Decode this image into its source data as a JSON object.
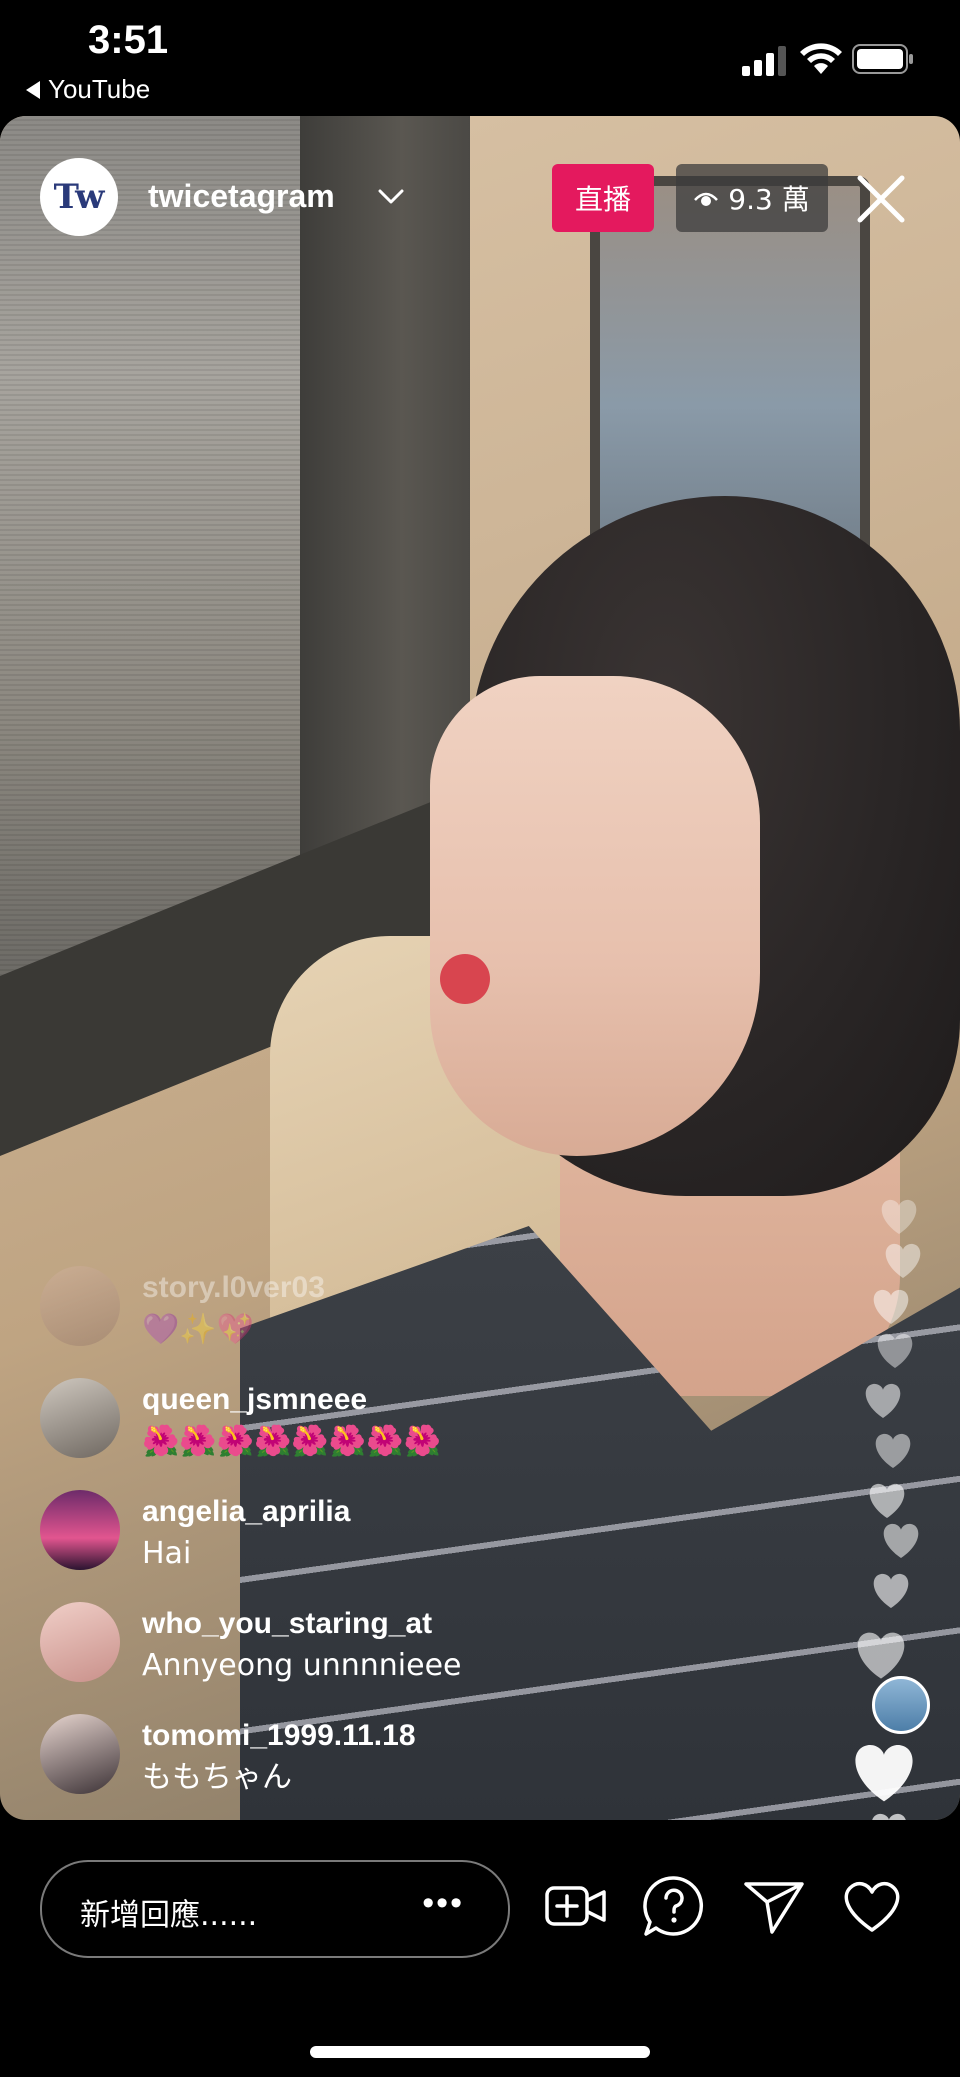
{
  "status_bar": {
    "time": "3:51",
    "back_app": "YouTube"
  },
  "live": {
    "account_handle": "twicetagram",
    "avatar_logo_text": "Tw",
    "live_label": "直播",
    "viewer_count": "9.3 萬"
  },
  "comments": [
    {
      "username": "story.l0ver03",
      "text": "💜✨💖",
      "faded": true
    },
    {
      "username": "queen_jsmneee",
      "text": "🌺🌺🌺🌺🌺🌺🌺🌺"
    },
    {
      "username": "angelia_aprilia",
      "text": "Hai"
    },
    {
      "username": "who_you_staring_at",
      "text": "Annyeong unnnnieee"
    },
    {
      "username": "tomomi_1999.11.18",
      "text": "ももちゃん"
    }
  ],
  "bottom_bar": {
    "comment_placeholder": "新增回應......",
    "more": "•••"
  },
  "colors": {
    "live_badge": "#e4195e",
    "viewer_badge": "#3c3c3c"
  },
  "icons": [
    "signal-icon",
    "wifi-icon",
    "battery-icon",
    "chevron-down-icon",
    "eye-icon",
    "close-icon",
    "add-video-icon",
    "question-icon",
    "send-icon",
    "heart-icon"
  ]
}
